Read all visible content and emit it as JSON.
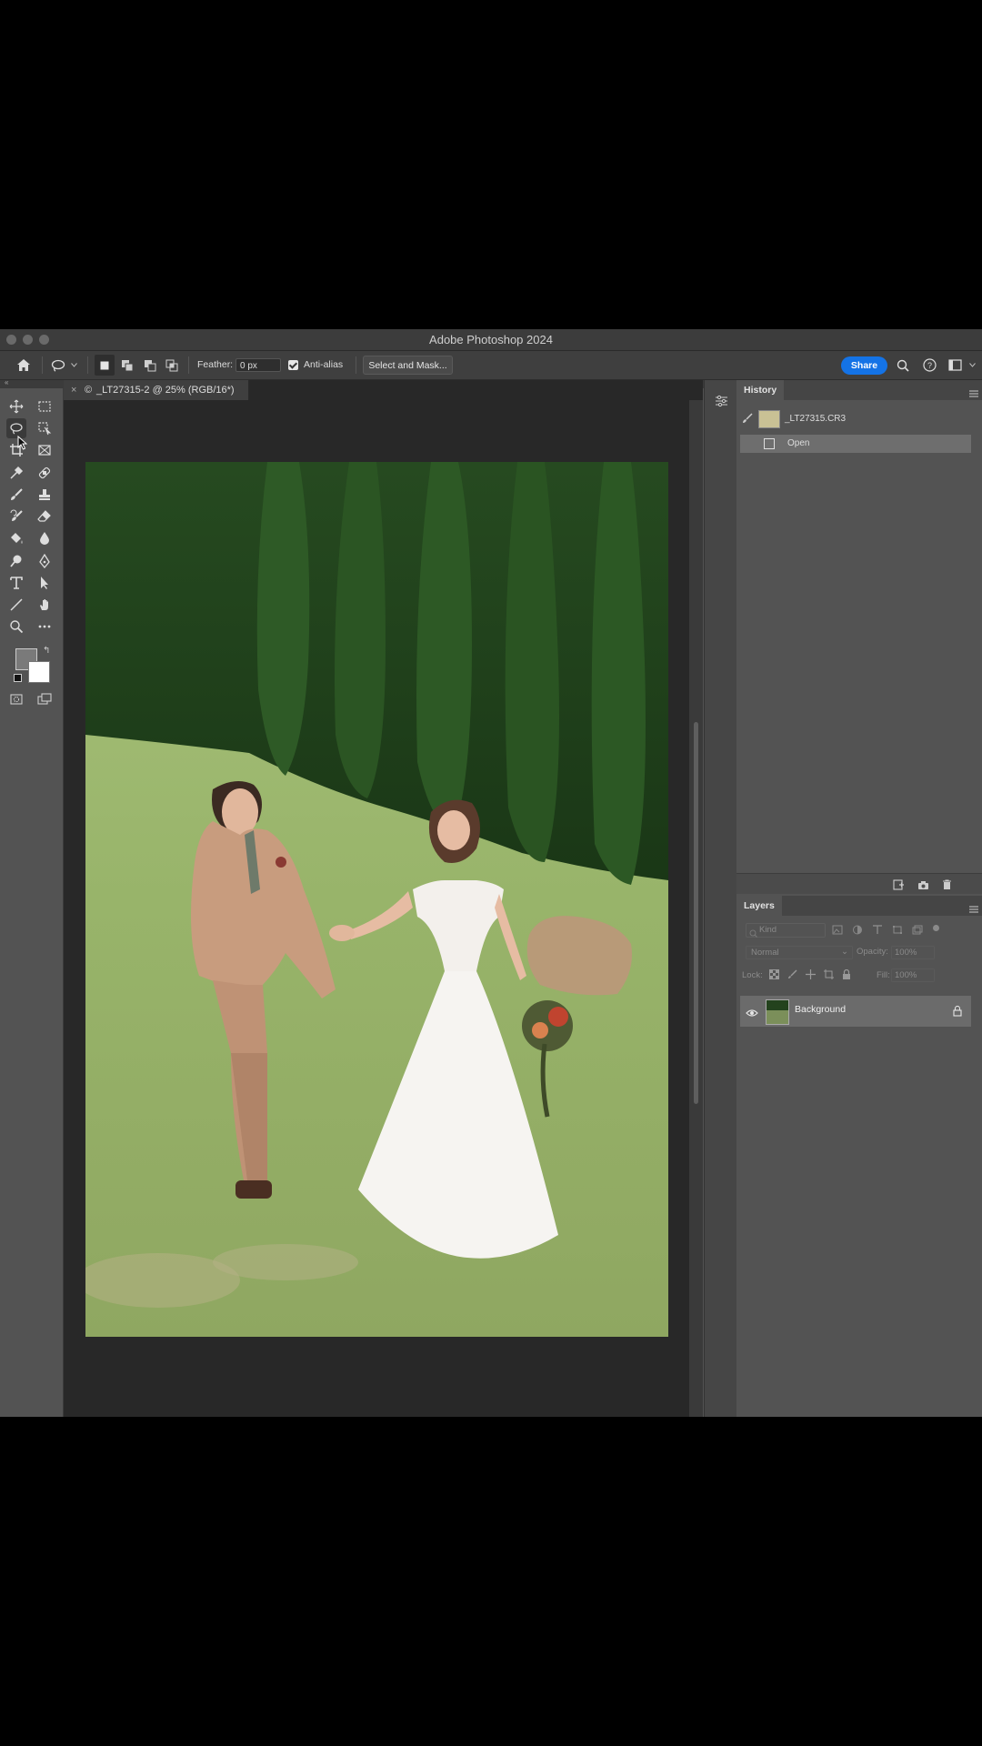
{
  "app": {
    "title": "Adobe Photoshop 2024"
  },
  "options": {
    "feather_label": "Feather:",
    "feather_value": "0 px",
    "antialias_label": "Anti-alias",
    "antialias_checked": true,
    "select_mask_label": "Select and Mask...",
    "share_label": "Share"
  },
  "document": {
    "tab_title": "_LT27315-2 @ 25% (RGB/16*)",
    "close_glyph": "×",
    "flag_glyph": "©"
  },
  "history": {
    "tab_label": "History",
    "snapshot_name": "_LT27315.CR3",
    "states": [
      {
        "label": "Open"
      }
    ]
  },
  "layers": {
    "tab_label": "Layers",
    "filter_placeholder": "Kind",
    "blend_mode": "Normal",
    "opacity_label": "Opacity:",
    "opacity_value": "100%",
    "lock_label": "Lock:",
    "fill_label": "Fill:",
    "fill_value": "100%",
    "items": [
      {
        "name": "Background",
        "visible": true,
        "locked": true
      }
    ]
  },
  "colors": {
    "accent": "#1473e6",
    "foreground_swatch": "#7a7a7a",
    "background_swatch": "#ffffff"
  }
}
